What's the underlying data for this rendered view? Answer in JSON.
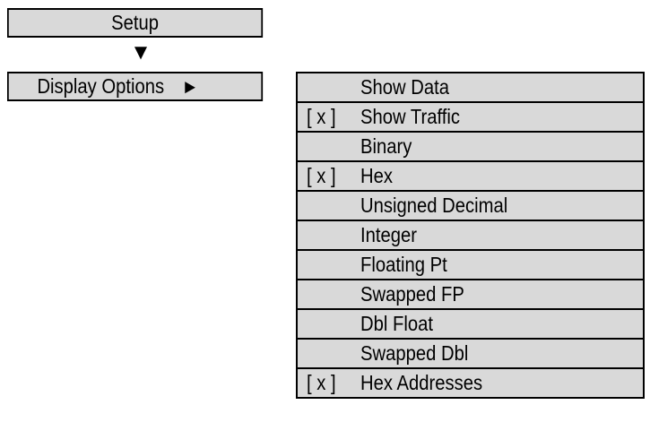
{
  "setup": {
    "label": "Setup",
    "arrow": "▼"
  },
  "display_options": {
    "label": "Display Options",
    "arrow": "►"
  },
  "menu": {
    "items": [
      {
        "check": "",
        "label": "Show Data"
      },
      {
        "check": "[ x ]",
        "label": "Show Traffic"
      },
      {
        "check": "",
        "label": "Binary"
      },
      {
        "check": "[ x ]",
        "label": "Hex"
      },
      {
        "check": "",
        "label": "Unsigned Decimal"
      },
      {
        "check": "",
        "label": "Integer"
      },
      {
        "check": "",
        "label": "Floating Pt"
      },
      {
        "check": "",
        "label": "Swapped FP"
      },
      {
        "check": "",
        "label": "Dbl Float"
      },
      {
        "check": "",
        "label": "Swapped Dbl"
      },
      {
        "check": "[ x ]",
        "label": "Hex Addresses"
      }
    ]
  },
  "colors": {
    "box_fill": "#d9d9d9",
    "border": "#000000"
  }
}
